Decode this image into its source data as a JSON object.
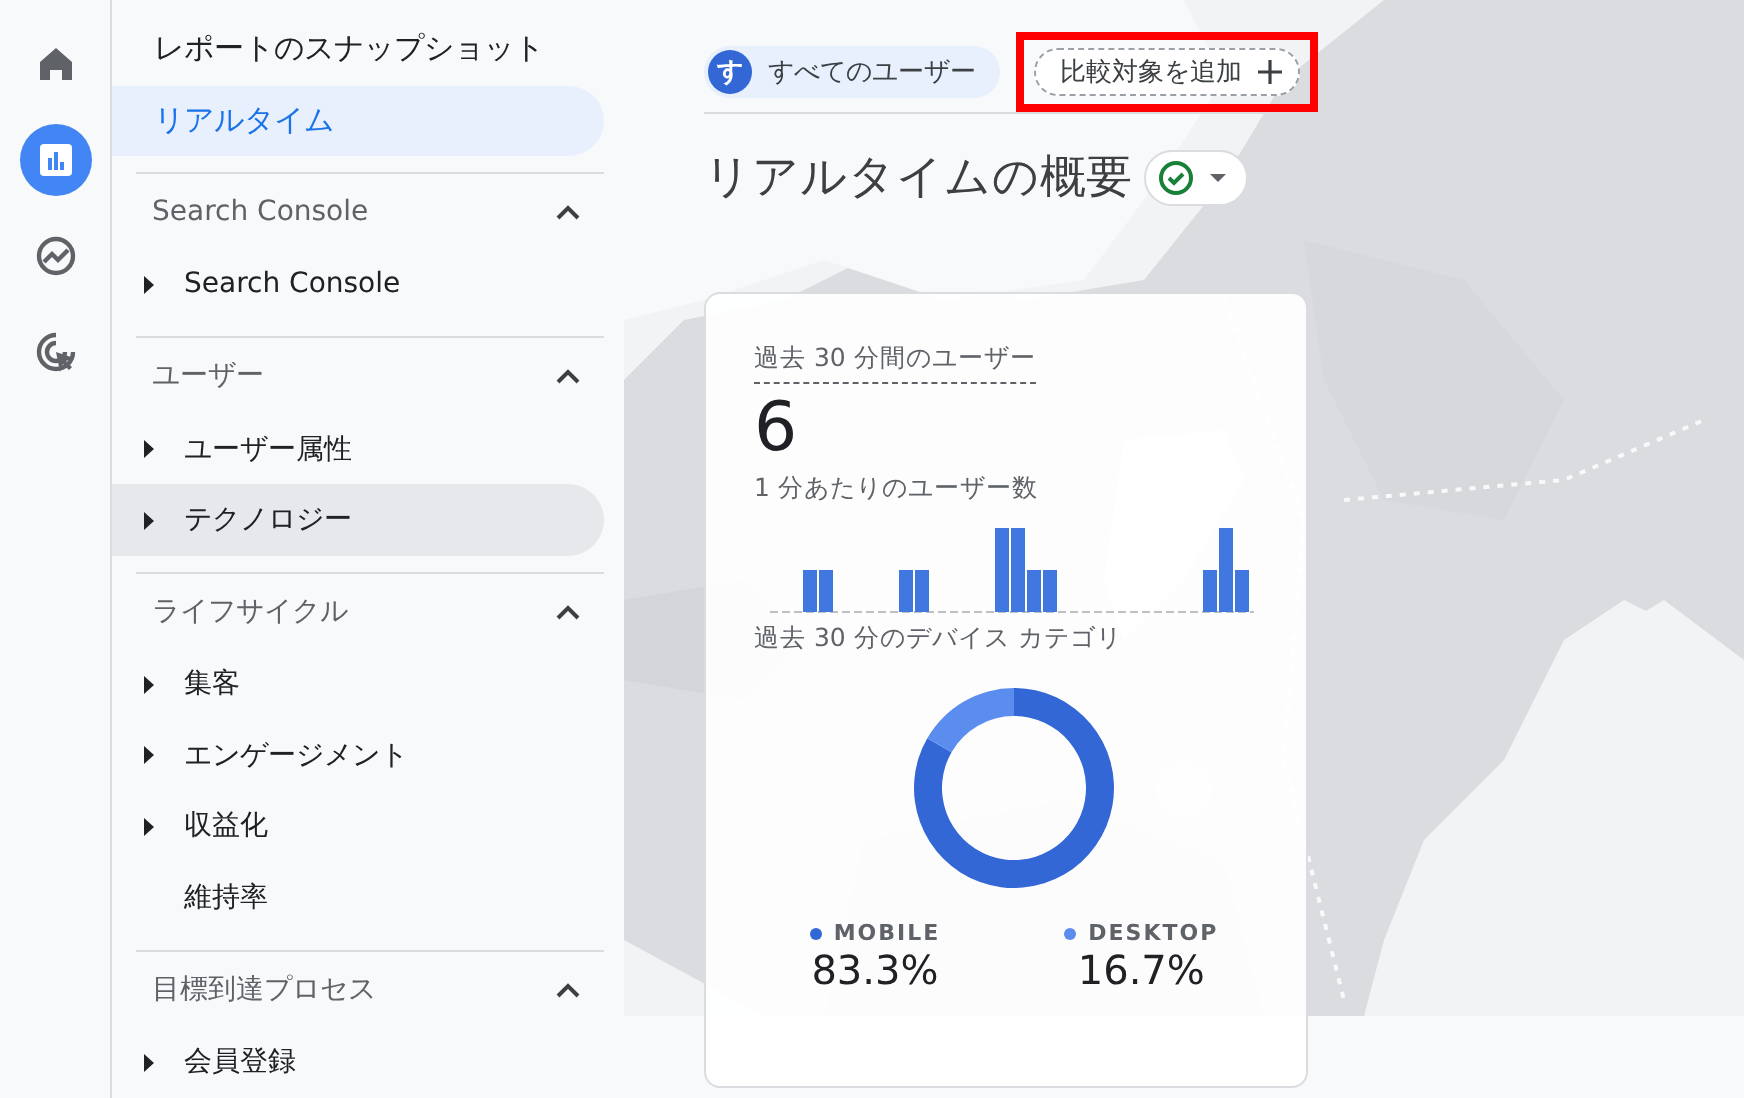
{
  "rail": [
    {
      "kind": "home",
      "selected": false
    },
    {
      "kind": "reports",
      "selected": true
    },
    {
      "kind": "explore",
      "selected": false
    },
    {
      "kind": "advertising",
      "selected": false
    }
  ],
  "nav": {
    "top_items": [
      {
        "label": "レポートのスナップショット",
        "selected": false
      },
      {
        "label": "リアルタイム",
        "selected": true
      }
    ],
    "sections": [
      {
        "title": "Search Console",
        "expanded": true,
        "items": [
          {
            "label": "Search Console",
            "expandable": true,
            "hovered": false
          }
        ]
      },
      {
        "title": "ユーザー",
        "expanded": true,
        "items": [
          {
            "label": "ユーザー属性",
            "expandable": true,
            "hovered": false
          },
          {
            "label": "テクノロジー",
            "expandable": true,
            "hovered": true
          }
        ]
      },
      {
        "title": "ライフサイクル",
        "expanded": true,
        "items": [
          {
            "label": "集客",
            "expandable": true,
            "hovered": false
          },
          {
            "label": "エンゲージメント",
            "expandable": true,
            "hovered": false
          },
          {
            "label": "収益化",
            "expandable": true,
            "hovered": false
          },
          {
            "label": "維持率",
            "expandable": false,
            "hovered": false
          }
        ]
      },
      {
        "title": "目標到達プロセス",
        "expanded": true,
        "items": [
          {
            "label": "会員登録",
            "expandable": true,
            "hovered": false
          }
        ]
      }
    ]
  },
  "segments": {
    "current": {
      "avatar": "す",
      "label": "すべてのユーザー"
    },
    "compare": {
      "label": "比較対象を追加",
      "highlighted": true
    }
  },
  "page_title": "リアルタイムの概要",
  "card": {
    "users_label": "過去 30 分間のユーザー",
    "users_value": "6",
    "per_minute_label": "1 分あたりのユーザー数",
    "device_label": "過去 30 分のデバイス カテゴリ",
    "slices": [
      {
        "color": "#3367d6"
      },
      {
        "color": "#5b8def"
      }
    ],
    "chart_data": {
      "type": "donut",
      "categories": [
        "MOBILE",
        "DESKTOP"
      ],
      "values": [
        83.3,
        16.7
      ],
      "value_labels": [
        "83.3%",
        "16.7%"
      ],
      "legend": "bottom"
    }
  }
}
